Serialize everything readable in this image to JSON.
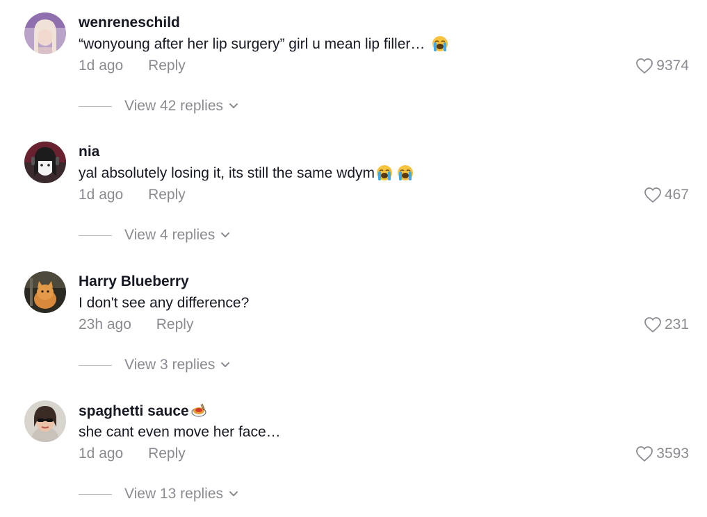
{
  "comments": [
    {
      "username": "wenreneschild",
      "text": "“wonyoung after her lip surgery” girl u mean lip filler…",
      "emojis": [
        "loudly-crying-face"
      ],
      "time": "1d ago",
      "reply_label": "Reply",
      "likes": "9374",
      "view_replies": "View 42 replies"
    },
    {
      "username": "nia",
      "text": "yal absolutely losing it, its still the same wdym",
      "emojis": [
        "loudly-crying-face",
        "loudly-crying-face"
      ],
      "time": "1d ago",
      "reply_label": "Reply",
      "likes": "467",
      "view_replies": "View 4 replies"
    },
    {
      "username": "Harry Blueberry",
      "text": "I don't see any difference?",
      "emojis": [],
      "time": "23h ago",
      "reply_label": "Reply",
      "likes": "231",
      "view_replies": "View 3 replies"
    },
    {
      "username": "spaghetti sauce",
      "username_badge": "spaghetti-emoji",
      "text": "she cant even move her face…",
      "emojis": [],
      "time": "1d ago",
      "reply_label": "Reply",
      "likes": "3593",
      "view_replies": "View 13 replies"
    }
  ],
  "icons": {
    "like": "heart-outline-icon",
    "expand": "chevron-down-icon"
  },
  "colors": {
    "primary_text": "#161823",
    "secondary_text": "#8a8b91",
    "divider": "#b9babe"
  }
}
